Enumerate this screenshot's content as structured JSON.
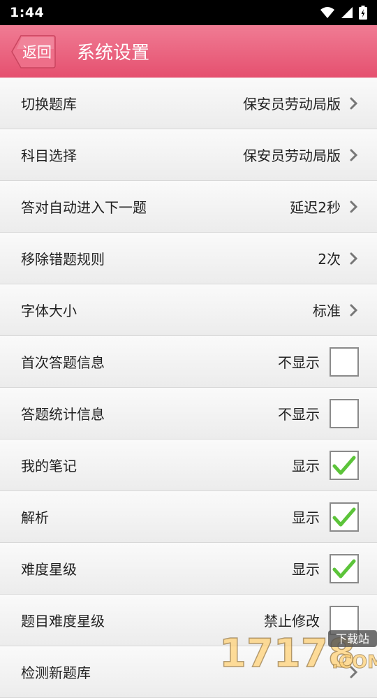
{
  "status": {
    "time": "1:44"
  },
  "header": {
    "back_label": "返回",
    "title": "系统设置"
  },
  "rows": [
    {
      "label": "切换题库",
      "value": "保安员劳动局版",
      "kind": "nav"
    },
    {
      "label": "科目选择",
      "value": "保安员劳动局版",
      "kind": "nav"
    },
    {
      "label": "答对自动进入下一题",
      "value": "延迟2秒",
      "kind": "nav"
    },
    {
      "label": "移除错题规则",
      "value": "2次",
      "kind": "nav"
    },
    {
      "label": "字体大小",
      "value": "标准",
      "kind": "nav"
    },
    {
      "label": "首次答题信息",
      "value": "不显示",
      "kind": "check",
      "checked": false
    },
    {
      "label": "答题统计信息",
      "value": "不显示",
      "kind": "check",
      "checked": false
    },
    {
      "label": "我的笔记",
      "value": "显示",
      "kind": "check",
      "checked": true
    },
    {
      "label": "解析",
      "value": "显示",
      "kind": "check",
      "checked": true
    },
    {
      "label": "难度星级",
      "value": "显示",
      "kind": "check",
      "checked": true
    },
    {
      "label": "题目难度星级",
      "value": "禁止修改",
      "kind": "check",
      "checked": false
    },
    {
      "label": "检测新题库",
      "value": "",
      "kind": "nav"
    }
  ],
  "watermark": {
    "number": "17178",
    "tag": "下载站",
    "domain": ".COM"
  },
  "colors": {
    "header_top": "#f07c94",
    "header_bottom": "#e5506f",
    "check": "#5cc43a"
  }
}
